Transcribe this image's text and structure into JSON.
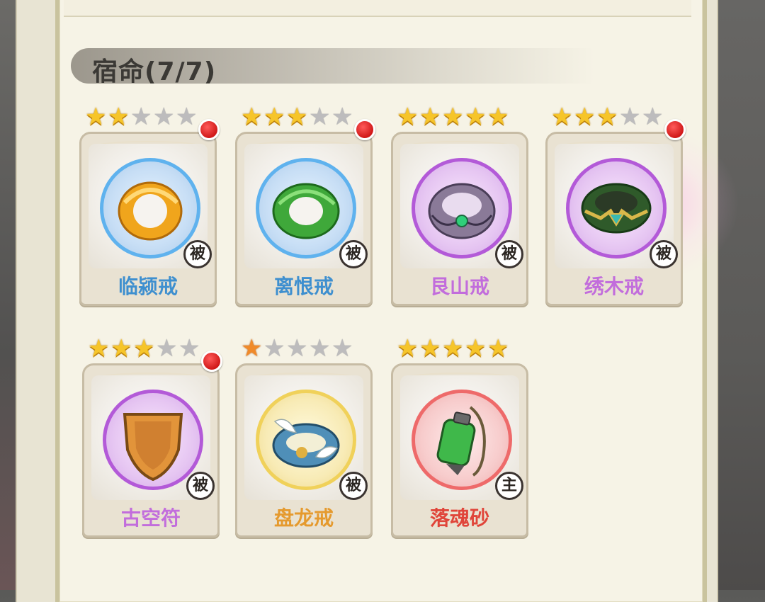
{
  "panel": {
    "title": "宿命(7/7)"
  },
  "cards": [
    {
      "name": "临颍戒",
      "stars": 2,
      "star_color": "gold",
      "badge": "被",
      "red_dot": true,
      "name_color": "#3e8fcf",
      "ring": "blue",
      "item_icon": "gold-ring-icon"
    },
    {
      "name": "离恨戒",
      "stars": 3,
      "star_color": "gold",
      "badge": "被",
      "red_dot": true,
      "name_color": "#3e8fcf",
      "ring": "blue",
      "item_icon": "green-jade-ring-icon"
    },
    {
      "name": "艮山戒",
      "stars": 5,
      "star_color": "gold",
      "badge": "被",
      "red_dot": false,
      "name_color": "#c26ddc",
      "ring": "purple",
      "item_icon": "silver-gem-ring-icon"
    },
    {
      "name": "绣木戒",
      "stars": 3,
      "star_color": "gold",
      "badge": "被",
      "red_dot": true,
      "name_color": "#c26ddc",
      "ring": "purple",
      "item_icon": "emerald-ornate-ring-icon"
    },
    {
      "name": "古空符",
      "stars": 3,
      "star_color": "gold",
      "badge": "被",
      "red_dot": true,
      "name_color": "#c26ddc",
      "ring": "purple",
      "item_icon": "bronze-talisman-icon"
    },
    {
      "name": "盘龙戒",
      "stars": 1,
      "star_color": "orange",
      "badge": "被",
      "red_dot": false,
      "name_color": "#e59a2e",
      "ring": "gold",
      "item_icon": "winged-ring-icon"
    },
    {
      "name": "落魂砂",
      "stars": 5,
      "star_color": "gold",
      "badge": "主",
      "red_dot": false,
      "name_color": "#e0453a",
      "ring": "red",
      "item_icon": "sand-vial-icon"
    }
  ]
}
